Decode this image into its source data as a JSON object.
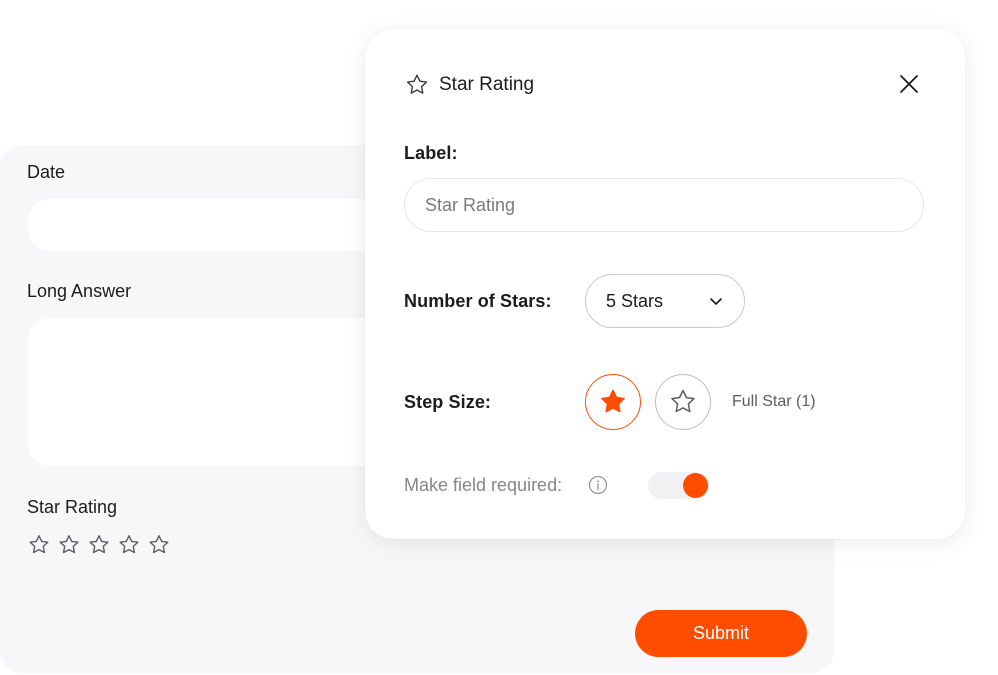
{
  "form": {
    "date_label": "Date",
    "long_answer_label": "Long Answer",
    "star_rating_label": "Star Rating",
    "star_rating_value": 0,
    "star_rating_max": 5,
    "submit_label": "Submit"
  },
  "panel": {
    "title": "Star Rating",
    "title_icon": "star-outline-icon",
    "close_icon": "close-icon",
    "label_field": {
      "title": "Label:",
      "placeholder": "Star Rating",
      "value": ""
    },
    "number_of_stars": {
      "title": "Number of Stars:",
      "selected": "5 Stars"
    },
    "step_size": {
      "title": "Step Size:",
      "options": [
        "full-star-icon",
        "half-star-icon"
      ],
      "selected_index": 0,
      "caption": "Full Star (1)"
    },
    "required": {
      "label": "Make field required:",
      "info_icon": "info-icon",
      "enabled": true
    }
  },
  "colors": {
    "accent": "#ff4d00",
    "form_background": "#f7f7f9",
    "text_primary": "#1c1c1e",
    "text_muted": "#86868b"
  }
}
